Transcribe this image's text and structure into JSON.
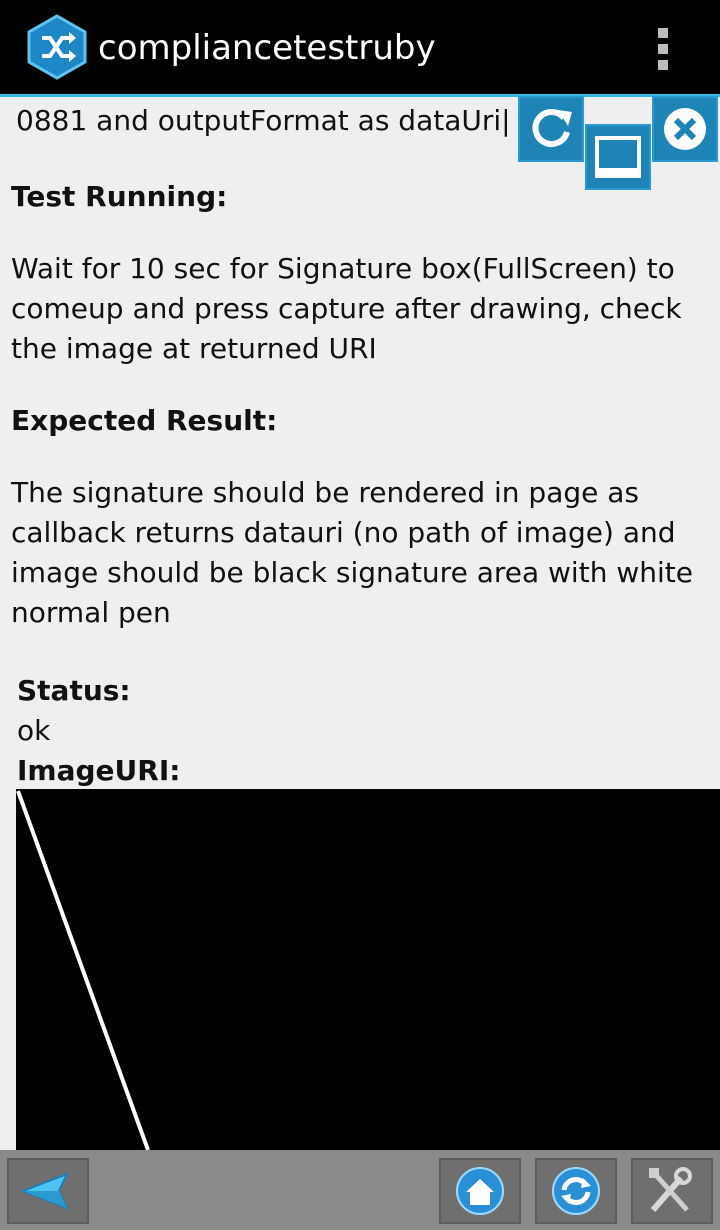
{
  "app": {
    "title": "compliancetestruby",
    "icon": "shuffle-icon",
    "overflow_icon": "overflow-menu-icon"
  },
  "content": {
    "input_line": "0881 and outputFormat as dataUri|",
    "test_running_heading": "Test Running:",
    "test_running_text": "Wait for 10 sec for Signature box(FullScreen) to comeup and press capture after drawing, check the image at returned URI",
    "expected_heading": "Expected Result:",
    "expected_text": "The signature should be rendered in page as callback returns datauri (no path of image) and image should be black signature area with white normal pen",
    "status_label": "Status:",
    "status_value": "ok",
    "image_uri_label": "ImageURI:"
  },
  "floating_buttons": [
    {
      "icon": "refresh-icon"
    },
    {
      "icon": "minimize-icon"
    },
    {
      "icon": "close-icon"
    }
  ],
  "toolbar": {
    "buttons": [
      {
        "icon": "back-arrow-icon"
      },
      {
        "icon": "home-icon"
      },
      {
        "icon": "sync-icon"
      },
      {
        "icon": "tools-icon"
      }
    ]
  },
  "colors": {
    "action_bar": "#000000",
    "accent": "#33b5e5",
    "button_blue": "#1d84b5",
    "toolbar": "#8a8a8a",
    "background": "#efefef"
  }
}
